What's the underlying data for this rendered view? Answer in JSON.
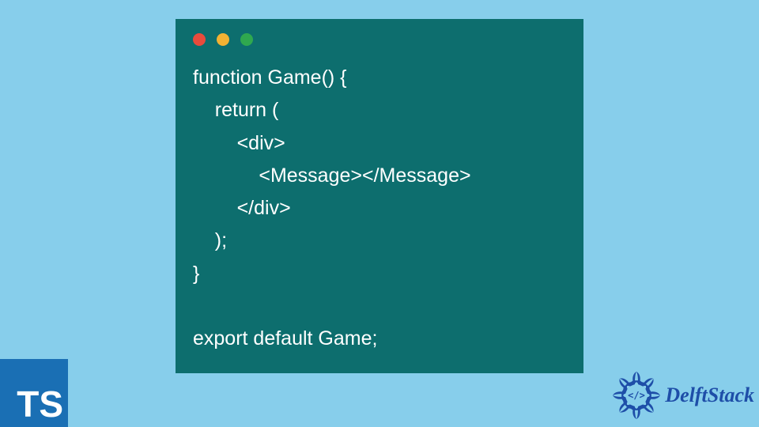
{
  "code": {
    "lines": [
      "function Game() {",
      "    return (",
      "        <div>",
      "            <Message></Message>",
      "        </div>",
      "    );",
      "}",
      "",
      "export default Game;"
    ]
  },
  "ts_badge": {
    "label": "TS"
  },
  "brand": {
    "name": "DelftStack"
  },
  "colors": {
    "page_bg": "#87ceeb",
    "code_bg": "#0d6e6e",
    "code_fg": "#ffffff",
    "ts_bg": "#1a6fb4",
    "brand_fg": "#1e4ea8"
  }
}
